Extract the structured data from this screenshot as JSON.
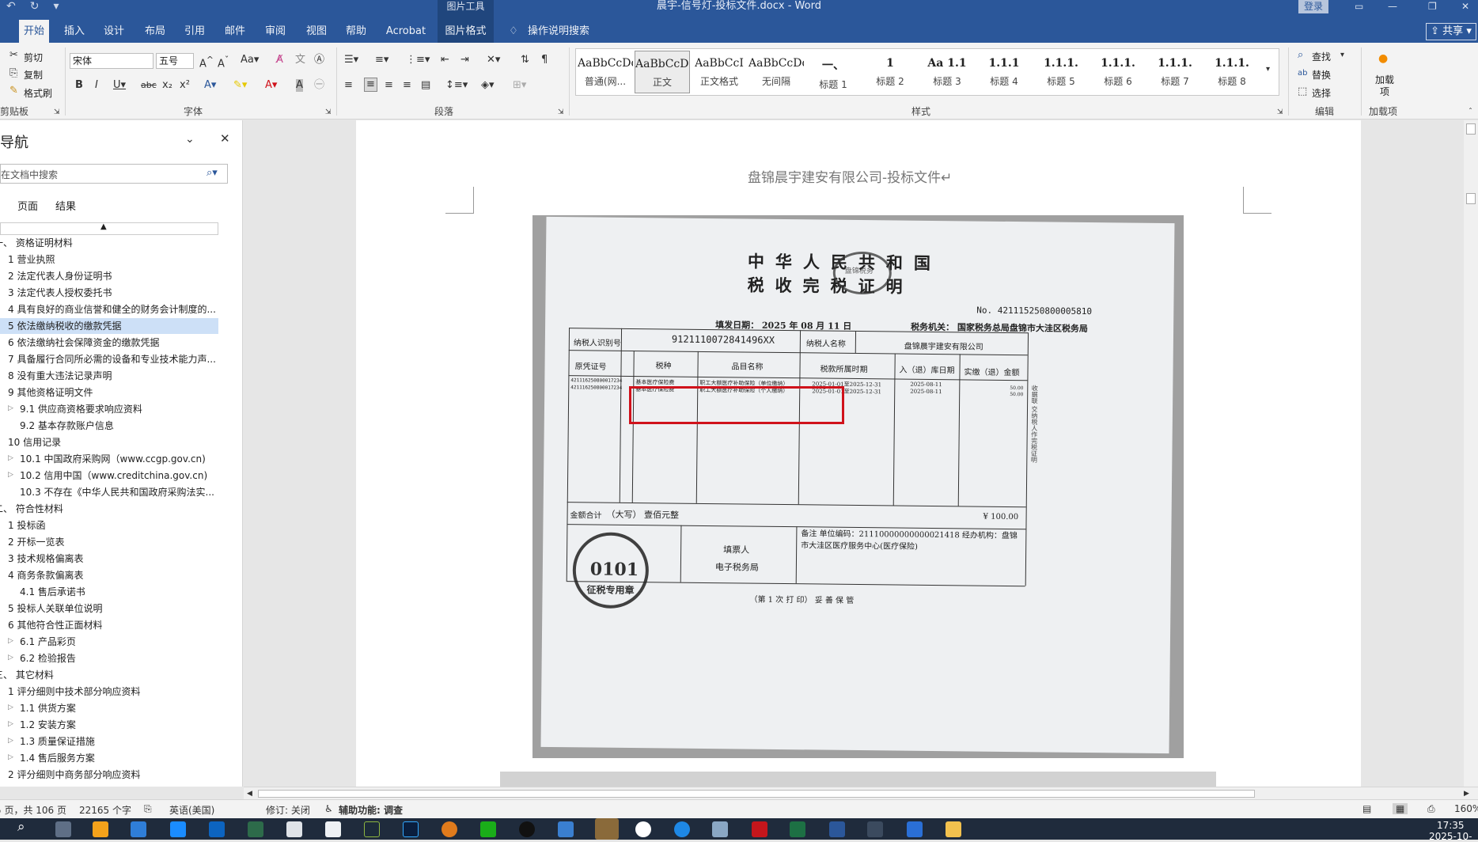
{
  "window": {
    "context_tool": "图片工具",
    "title": "晨宇-信号灯-投标文件.docx - Word",
    "login": "登录",
    "share": "共享"
  },
  "tabs": [
    "开始",
    "插入",
    "设计",
    "布局",
    "引用",
    "邮件",
    "审阅",
    "视图",
    "帮助",
    "Acrobat",
    "图片格式"
  ],
  "tell_me": "操作说明搜索",
  "ribbon": {
    "clipboard": {
      "cut": "剪切",
      "copy": "复制",
      "format_painter": "格式刷",
      "label": "剪贴板"
    },
    "font": {
      "name": "宋体",
      "size": "五号",
      "label": "字体"
    },
    "paragraph": {
      "label": "段落"
    },
    "styles": {
      "label": "样式",
      "items": [
        {
          "preview": "AaBbCcDd",
          "name": "普通(网..."
        },
        {
          "preview": "AaBbCcDd",
          "name": "正文"
        },
        {
          "preview": "AaBbCcI",
          "name": "正文格式"
        },
        {
          "preview": "AaBbCcDd",
          "name": "无间隔"
        },
        {
          "preview": "一、",
          "name": "标题 1"
        },
        {
          "preview": "1",
          "name": "标题 2"
        },
        {
          "preview": "Aa 1.1",
          "name": "标题 3"
        },
        {
          "preview": "1.1.1",
          "name": "标题 4"
        },
        {
          "preview": "1.1.1.",
          "name": "标题 5"
        },
        {
          "preview": "1.1.1.",
          "name": "标题 6"
        },
        {
          "preview": "1.1.1.",
          "name": "标题 7"
        },
        {
          "preview": "1.1.1.",
          "name": "标题 8"
        }
      ]
    },
    "editing": {
      "find": "查找",
      "replace": "替换",
      "select": "选择",
      "label": "编辑"
    },
    "addins": {
      "btn": "加载项",
      "label": "加载项"
    }
  },
  "nav": {
    "title": "导航",
    "search_placeholder": "在文档中搜索",
    "tab_pages": "页面",
    "tab_results": "结果",
    "items": [
      "一、 资格证明材料",
      "1 营业执照",
      "2 法定代表人身份证明书",
      "3 法定代表人授权委托书",
      "4 具有良好的商业信誉和健全的财务会计制度的...",
      "5 依法缴纳税收的缴款凭据",
      "6 依法缴纳社会保障资金的缴款凭据",
      "7 具备履行合同所必需的设备和专业技术能力声...",
      "8 没有重大违法记录声明",
      "9 其他资格证明文件",
      "9.1 供应商资格要求响应资料",
      "9.2 基本存款账户信息",
      "10 信用记录",
      "10.1 中国政府采购网（www.ccgp.gov.cn)",
      "10.2 信用中国（www.creditchina.gov.cn)",
      "10.3 不存在《中华人民共和国政府采购法实...",
      "二、 符合性材料",
      "1 投标函",
      "2 开标一览表",
      "3 技术规格偏离表",
      "4 商务条款偏离表",
      "4.1 售后承诺书",
      "5 投标人关联单位说明",
      "6 其他符合性正面材料",
      "6.1 产品彩页",
      "6.2 检验报告",
      "三、 其它材料",
      "1 评分细则中技术部分响应资料",
      "1.1 供货方案",
      "1.2 安装方案",
      "1.3 质量保证措施",
      "1.4 售后服务方案",
      "2 评分细则中商务部分响应资料"
    ]
  },
  "document": {
    "header": "盘锦晨宇建安有限公司-投标文件↵",
    "certificate": {
      "title_line1": "中华人民共和国",
      "title_line2": "税收完税证明",
      "seal_top": "盘锦税务",
      "no": "No. 421115250800005810",
      "fill_date": "填发日期：  2025 年  08 月  11 日",
      "tax_authority": "税务机关：  国家税务总局盘锦市大洼区税务局",
      "taxpayer_id_label": "纳税人识别号",
      "taxpayer_id": "9121110072841496XX",
      "taxpayer_name_label": "纳税人名称",
      "taxpayer_name": "盘锦晨宇建安有限公司",
      "col_original": "原凭证号",
      "col_tax_type": "税种",
      "col_item": "品目名称",
      "col_period": "税款所属时期",
      "col_date": "入（退）库日期",
      "col_amount": "实缴（退）金额",
      "rows": [
        {
          "orig": "421116250800017234",
          "type": "基本医疗保险费",
          "item": "职工大额医疗补助保险（单位缴纳）",
          "period": "2025-01-01至2025-12-31",
          "date": "2025-08-11",
          "amount": "50.00"
        },
        {
          "orig": "421116250800017234",
          "type": "基本医疗保险费",
          "item": "职工大额医疗补助保险（个人缴纳）",
          "period": "2025-01-01至2025-12-31",
          "date": "2025-08-11",
          "amount": "50.00"
        }
      ],
      "side_note": "收据联  交纳税人作完税证明",
      "total_label": "金额合计",
      "total_upper": "（大写）  壹佰元整",
      "total_amount": "¥ 100.00",
      "filler_label": "填票人",
      "filler_value": "电子税务局",
      "remark": "备注  单位编码：21110000000000021418  经办机构：盘锦市大洼区医疗服务中心(医疗保险)",
      "seal_number": "0101",
      "seal_text": "征税专用章",
      "footer": "（第 1 次 打 印） 妥 善 保 管"
    }
  },
  "status": {
    "page": "第 5 页，共 106 页",
    "words": "22165 个字",
    "lang": "英语(美国)",
    "track": "修订: 关闭",
    "access": "辅助功能: 调查",
    "zoom": "160%"
  },
  "clock": {
    "time": "17:35",
    "date": "2025-10-"
  },
  "colors": {
    "accent": "#2b579a",
    "highlight_box": "#d0121b",
    "nav_selected": "#cde0f7"
  }
}
